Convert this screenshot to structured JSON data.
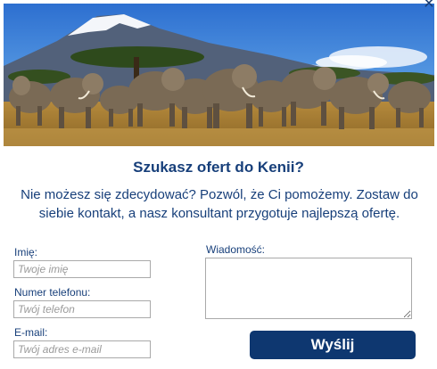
{
  "close": {
    "icon": "close-icon",
    "glyph": "✕"
  },
  "hero": {
    "description_icon": "safari-elephants-image"
  },
  "heading": "Szukasz ofert do Kenii?",
  "intro": "Nie możesz się zdecydować? Pozwól, że Ci pomożemy. Zostaw do siebie kontakt, a nasz konsultant przygotuje najlepszą ofertę.",
  "form": {
    "name_label": "Imię:",
    "name_placeholder": "Twoje imię",
    "phone_label": "Numer telefonu:",
    "phone_placeholder": "Twój telefon",
    "email_label": "E-mail:",
    "email_placeholder": "Twój adres e-mail",
    "message_label": "Wiadomość:",
    "submit_label": "Wyślij"
  },
  "colors": {
    "accent": "#173f7a",
    "button": "#0e3770"
  }
}
